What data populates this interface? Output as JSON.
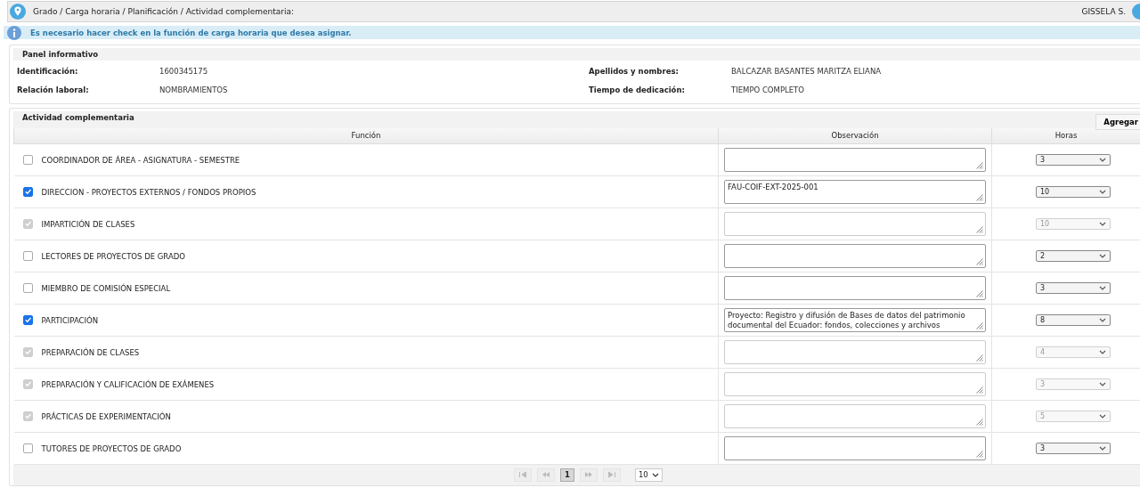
{
  "breadcrumb": "Grado / Carga horaria / Planificación / Actividad complementaria:",
  "user": "GISSELA S.",
  "notice": "Es necesario hacer check en la función de carga horaria que desea asignar.",
  "info_panel": {
    "title": "Panel informativo",
    "fields": [
      {
        "label": "Identificación:",
        "value": "1600345175"
      },
      {
        "label": "Apellidos y nombres:",
        "value": "BALCAZAR BASANTES MARITZA ELIANA"
      },
      {
        "label": "Relación laboral:",
        "value": "NOMBRAMIENTOS"
      },
      {
        "label": "Tiempo de dedicación:",
        "value": "TIEMPO COMPLETO"
      }
    ]
  },
  "activity_panel": {
    "title": "Actividad complementaria",
    "add_button": "Agregar",
    "columns": [
      "Función",
      "Observación",
      "Horas"
    ],
    "rows": [
      {
        "function": "COORDINADOR DE ÁREA - ASIGNATURA - SEMESTRE",
        "checked": false,
        "disabled": false,
        "observation": "",
        "hours": "3"
      },
      {
        "function": "DIRECCION - PROYECTOS EXTERNOS / FONDOS PROPIOS",
        "checked": true,
        "disabled": false,
        "observation": "FAU-COIF-EXT-2025-001",
        "hours": "10"
      },
      {
        "function": "IMPARTICIÓN DE CLASES",
        "checked": true,
        "disabled": true,
        "observation": "",
        "hours": "10"
      },
      {
        "function": "LECTORES DE PROYECTOS DE GRADO",
        "checked": false,
        "disabled": false,
        "observation": "",
        "hours": "2"
      },
      {
        "function": "MIEMBRO DE COMISIÓN ESPECIAL",
        "checked": false,
        "disabled": false,
        "observation": "",
        "hours": "3"
      },
      {
        "function": "PARTICIPACIÓN",
        "checked": true,
        "disabled": false,
        "observation": "Proyecto: Registro y difusión de Bases de datos del patrimonio documental del Ecuador: fondos, colecciones y archivos",
        "hours": "8"
      },
      {
        "function": "PREPARACIÓN DE CLASES",
        "checked": true,
        "disabled": true,
        "observation": "",
        "hours": "4"
      },
      {
        "function": "PREPARACIÓN Y CALIFICACIÓN DE EXÁMENES",
        "checked": true,
        "disabled": true,
        "observation": "",
        "hours": "3"
      },
      {
        "function": "PRÁCTICAS DE EXPERIMENTACIÓN",
        "checked": true,
        "disabled": true,
        "observation": "",
        "hours": "5"
      },
      {
        "function": "TUTORES DE PROYECTOS DE GRADO",
        "checked": false,
        "disabled": false,
        "observation": "",
        "hours": "3"
      }
    ],
    "pagination": {
      "pages": [
        {
          "label": "1",
          "selected": true
        }
      ],
      "page_size": "10"
    }
  }
}
